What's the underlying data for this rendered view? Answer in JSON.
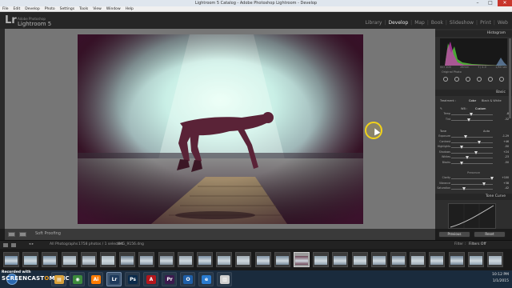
{
  "window": {
    "title": "Lightroom 5 Catalog - Adobe Photoshop Lightroom - Develop",
    "minimize": "–",
    "maximize": "□",
    "close": "✕"
  },
  "menu": [
    "File",
    "Edit",
    "Develop",
    "Photo",
    "Settings",
    "Tools",
    "View",
    "Window",
    "Help"
  ],
  "app": {
    "logo": "Lr",
    "brand_sub": "Adobe Photoshop",
    "brand_name": "Lightroom 5"
  },
  "modules": [
    "Library",
    "Develop",
    "Map",
    "Book",
    "Slideshow",
    "Print",
    "Web"
  ],
  "active_module": "Develop",
  "toolbar": {
    "soft_proofing": "Soft Proofing"
  },
  "right_panel": {
    "histogram_title": "Histogram",
    "histo_meta": [
      "ISO 100",
      "26mm",
      "f / 4.0",
      "1/80 sec"
    ],
    "original_photo": "Original Photo",
    "basic_title": "Basic",
    "treatment_label": "Treatment :",
    "treatment_options": [
      "Color",
      "Black & White"
    ],
    "wb_label": "WB :",
    "wb_value": "Custom",
    "tone_label": "Tone",
    "tone_auto": "Auto",
    "presence_label": "Presence",
    "sliders": [
      {
        "label": "Temp",
        "value": "-8"
      },
      {
        "label": "Tint",
        "value": "-32"
      },
      {
        "label": "Exposure",
        "value": "-1.29"
      },
      {
        "label": "Contrast",
        "value": "+46"
      },
      {
        "label": "Highlights",
        "value": "-50"
      },
      {
        "label": "Shadows",
        "value": "+24"
      },
      {
        "label": "Whites",
        "value": "-23"
      },
      {
        "label": "Blacks",
        "value": "-50"
      },
      {
        "label": "Clarity",
        "value": "+100"
      },
      {
        "label": "Vibrance",
        "value": "+38"
      },
      {
        "label": "Saturation",
        "value": "-42"
      }
    ],
    "tone_curve_title": "Tone Curve",
    "previous_button": "Previous",
    "reset_button": "Reset"
  },
  "filmstrip_header": {
    "source": "All Photographs",
    "count": "1758 photos / 1 selected",
    "filename": "/IMG_9156.dng",
    "filter_label": "Filter :",
    "filter_value": "Filters Off"
  },
  "taskbar": {
    "recorded_with": "Recorded with",
    "watermark_a": "SCREENCAST",
    "watermark_b": "O",
    "watermark_c": "MATIC",
    "time": "10:12 PM",
    "date": "1/1/2015",
    "apps": [
      "Explorer",
      "Chrome",
      "Illustrator",
      "Lightroom",
      "Photoshop",
      "Reader",
      "Premiere",
      "Outlook",
      "Internet Explorer",
      "Notepad"
    ]
  },
  "colors": {
    "photo_vignette": "#4a1d34",
    "glow": "#d8f4ee",
    "histogram_green": "#56c03c",
    "histogram_magenta": "#c83cb4",
    "accent_yellow": "#f2d21a"
  }
}
